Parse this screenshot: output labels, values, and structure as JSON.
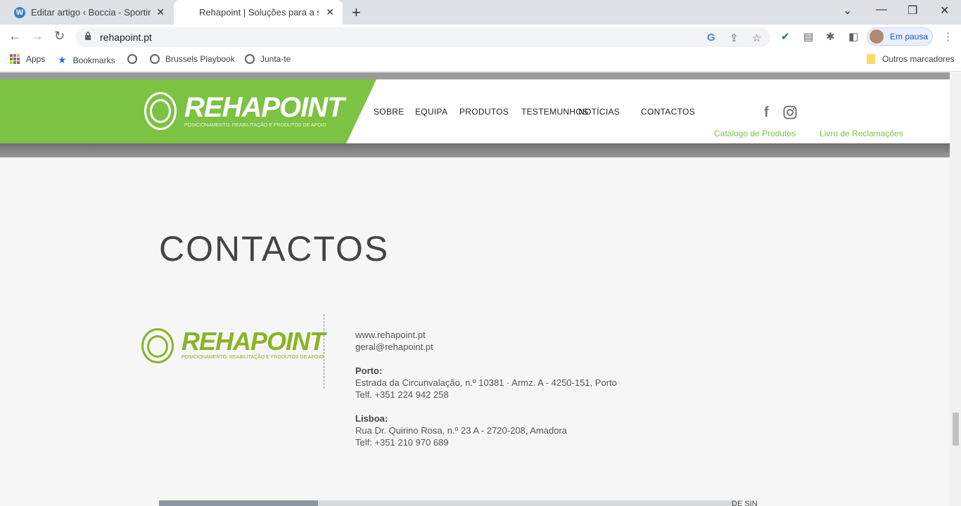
{
  "browser": {
    "tabs": [
      {
        "title": "Editar artigo ‹ Boccia - Sporting C",
        "active": false
      },
      {
        "title": "Rehapoint | Soluções para a sua r",
        "active": true
      }
    ],
    "url": "rehapoint.pt",
    "profile_label": "Em pausa",
    "bookmarks": [
      {
        "label": "Apps",
        "icon": "apps-grid-icon"
      },
      {
        "label": "Bookmarks",
        "icon": "star-icon"
      },
      {
        "label": "",
        "icon": "globe-icon"
      },
      {
        "label": "Brussels Playbook",
        "icon": "globe-icon"
      },
      {
        "label": "Junta-te",
        "icon": "globe-icon"
      }
    ],
    "other_bookmarks": "Outros marcadores"
  },
  "site": {
    "logo_text": "REHAPOINT",
    "logo_tagline": "POSICIONAMENTO, REABILITAÇÃO E PRODUTOS DE APOIO",
    "menu": [
      "SOBRE",
      "EQUIPA",
      "PRODUTOS",
      "TESTEMUNHOS",
      "NOTÍCIAS",
      "CONTACTOS"
    ],
    "links": {
      "catalog": "Catálogo de Produtos",
      "complaints": "Livro de Reclamações"
    },
    "accent_color": "#7cc243"
  },
  "contact_page": {
    "title": "CONTACTOS",
    "website": "www.rehapoint.pt",
    "email": "geral@rehapoint.pt",
    "porto": {
      "label": "Porto:",
      "address": "Estrada da Circunvalação, n.º 10381 · Armz. A - 4250-151, Porto",
      "phone": "Telf. +351 224 942 258"
    },
    "lisboa": {
      "label": "Lisboa:",
      "address": "Rua Dr. Quirino Rosa, n.º 23 A - 2720-208, Amadora",
      "phone": "Telf: +351 210 970 689"
    },
    "map_fragment_text": "DE SIN"
  }
}
